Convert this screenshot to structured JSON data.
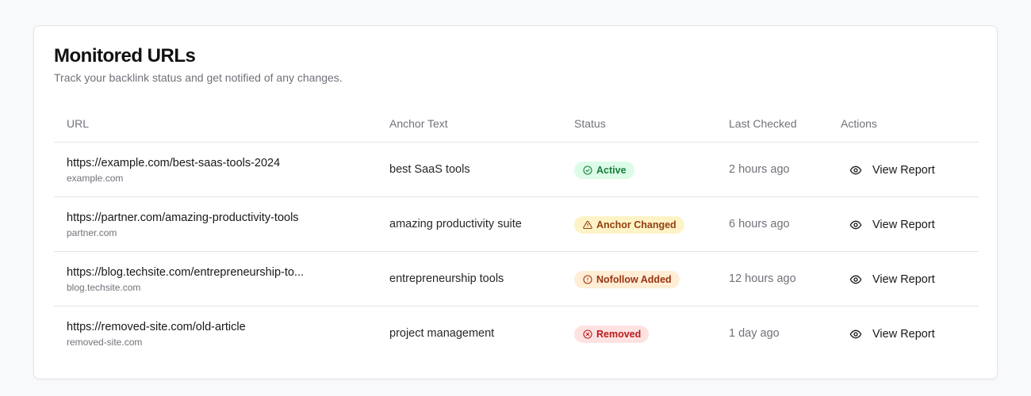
{
  "header": {
    "title": "Monitored URLs",
    "subtitle": "Track your backlink status and get notified of any changes."
  },
  "columns": {
    "url": "URL",
    "anchor": "Anchor Text",
    "status": "Status",
    "last_checked": "Last Checked",
    "actions": "Actions"
  },
  "rows": [
    {
      "url": "https://example.com/best-saas-tools-2024",
      "domain": "example.com",
      "anchor": "best SaaS tools",
      "status": "Active",
      "status_icon": "check-circle-icon",
      "last_checked": "2 hours ago",
      "action": "View Report"
    },
    {
      "url": "https://partner.com/amazing-productivity-tools",
      "domain": "partner.com",
      "anchor": "amazing productivity suite",
      "status": "Anchor Changed",
      "status_icon": "warning-triangle-icon",
      "last_checked": "6 hours ago",
      "action": "View Report"
    },
    {
      "url": "https://blog.techsite.com/entrepreneurship-to...",
      "domain": "blog.techsite.com",
      "anchor": "entrepreneurship tools",
      "status": "Nofollow Added",
      "status_icon": "alert-circle-icon",
      "last_checked": "12 hours ago",
      "action": "View Report"
    },
    {
      "url": "https://removed-site.com/old-article",
      "domain": "removed-site.com",
      "anchor": "project management",
      "status": "Removed",
      "status_icon": "x-circle-icon",
      "last_checked": "1 day ago",
      "action": "View Report"
    }
  ],
  "status_colors": {
    "Active": {
      "bg": "#dcfce7",
      "fg": "#15803d"
    },
    "Anchor Changed": {
      "bg": "#fef3c7",
      "fg": "#92400e"
    },
    "Nofollow Added": {
      "bg": "#ffedd5",
      "fg": "#9a3412"
    },
    "Removed": {
      "bg": "#fee2e2",
      "fg": "#b91c1c"
    }
  }
}
